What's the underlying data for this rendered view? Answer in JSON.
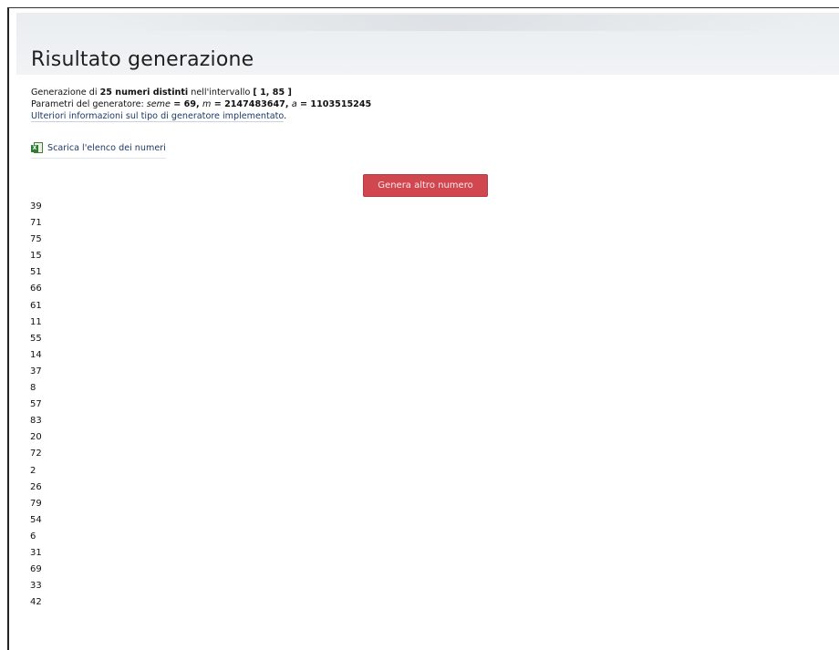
{
  "header": {
    "title": "Risultato generazione"
  },
  "info": {
    "line1": {
      "prefix": "Generazione di ",
      "count": "25 numeri distinti",
      "middle": " nell'intervallo ",
      "interval": "[ 1, 85 ]"
    },
    "line2": {
      "prefix": "Parametri del generatore: ",
      "seed_label": "seme",
      "seed_value": " = 69, ",
      "m_label": "m",
      "m_value": " = 2147483647, ",
      "a_label": "a",
      "a_value": " = 1103515245"
    },
    "link_text": "Ulteriori informazioni sul tipo di generatore implementato",
    "link_suffix": "."
  },
  "download": {
    "icon": "excel-icon",
    "label": "Scarica l'elenco dei numeri"
  },
  "generate_button": {
    "label": "Genera altro numero",
    "color": "#d1474f"
  },
  "numbers": [
    "39",
    "71",
    "75",
    "15",
    "51",
    "66",
    "61",
    "11",
    "55",
    "14",
    "37",
    "8",
    "57",
    "83",
    "20",
    "72",
    "2",
    "26",
    "79",
    "54",
    "6",
    "31",
    "69",
    "33",
    "42"
  ]
}
